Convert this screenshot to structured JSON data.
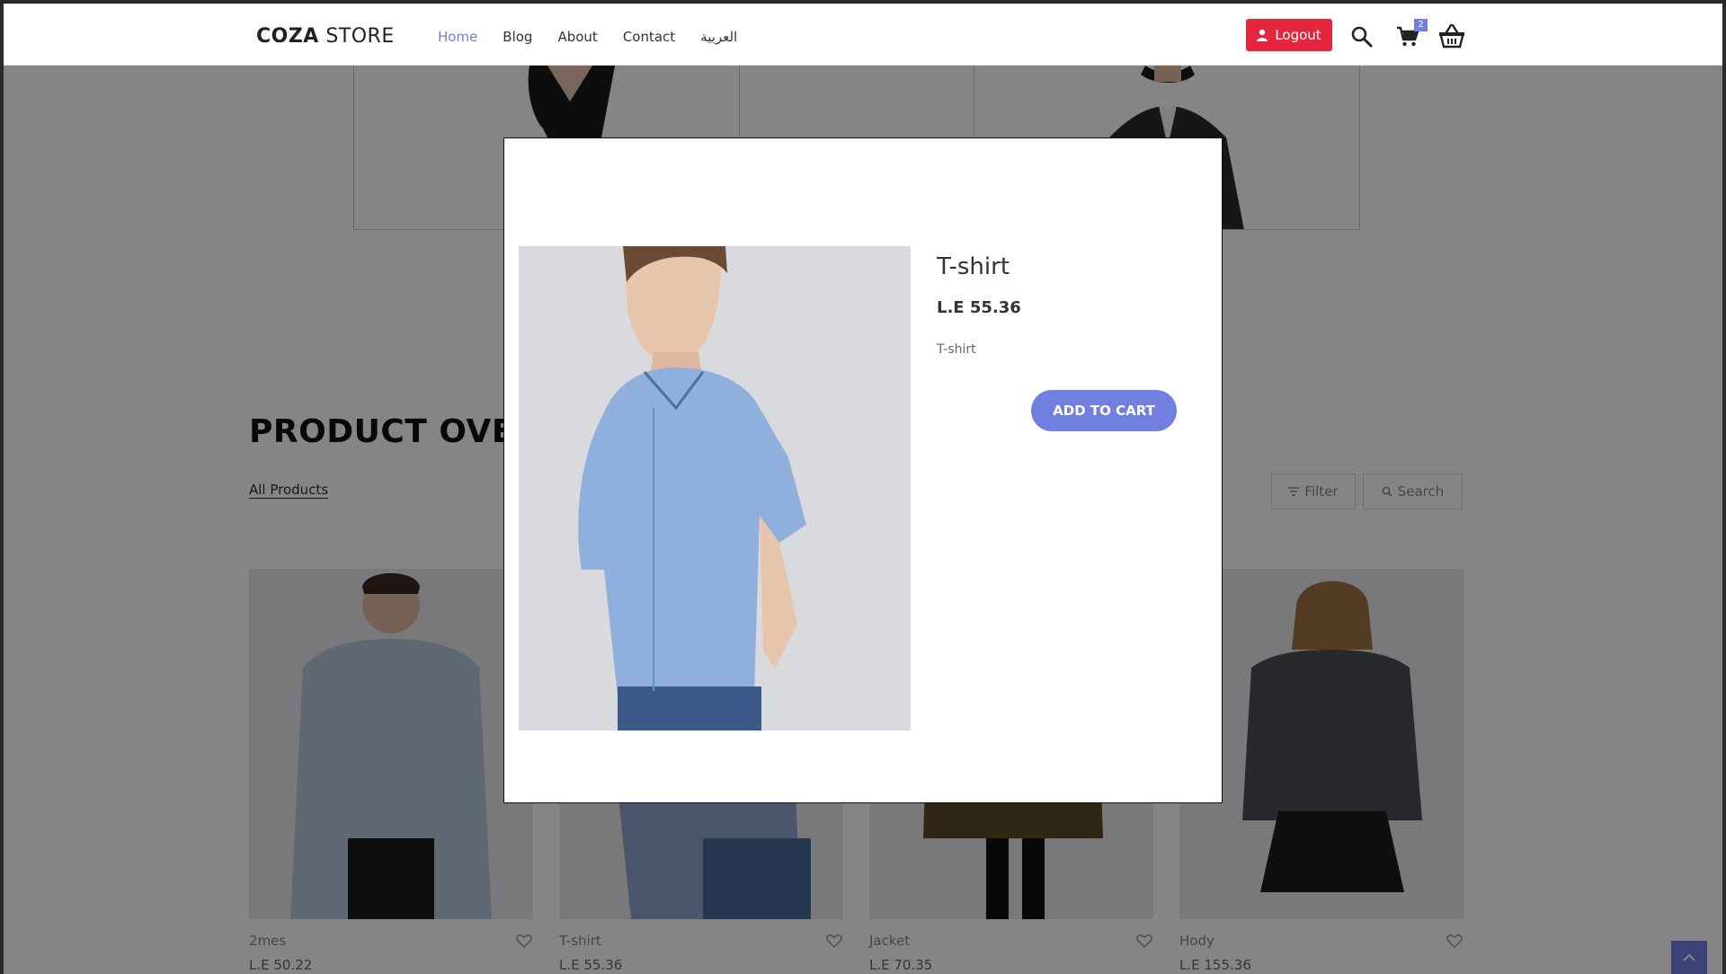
{
  "header": {
    "logo_bold": "COZA",
    "logo_rest": " STORE",
    "nav": [
      {
        "label": "Home",
        "active": true
      },
      {
        "label": "Blog"
      },
      {
        "label": "About"
      },
      {
        "label": "Contact"
      },
      {
        "label": "العربية"
      }
    ],
    "logout_label": "Logout",
    "cart_count": "2",
    "icons": [
      "user-icon",
      "search-icon",
      "cart-icon",
      "basket-icon"
    ]
  },
  "main": {
    "section_title": "PRODUCT OVERVIEW",
    "filter_all": "All Products",
    "filter_label": "Filter",
    "search_label": "Search",
    "products": [
      {
        "name": "2mes",
        "price": "L.E 50.22"
      },
      {
        "name": "T-shirt",
        "price": "L.E 55.36"
      },
      {
        "name": "Jacket",
        "price": "L.E 70.35"
      },
      {
        "name": "Hody",
        "price": "L.E 155.36"
      }
    ]
  },
  "modal": {
    "title": "T-shirt",
    "price": "L.E 55.36",
    "description": "T-shirt",
    "add_to_cart": "ADD TO CART"
  },
  "colors": {
    "accent": "#717fe0",
    "logout": "#e3263d",
    "overlay": "rgba(0,0,0,0.48)"
  }
}
